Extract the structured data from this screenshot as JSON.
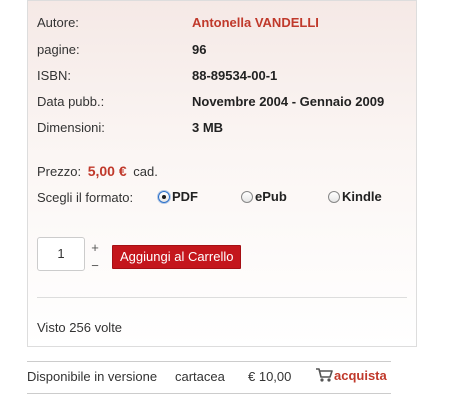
{
  "details": [
    {
      "label": "Autore:",
      "value": "Antonella VANDELLI"
    },
    {
      "label": "pagine:",
      "value": "96"
    },
    {
      "label": "ISBN:",
      "value": "88-89534-00-1"
    },
    {
      "label": "Data pubb.:",
      "value": "Novembre 2004 - Gennaio 2009"
    },
    {
      "label": "Dimensioni:",
      "value": "3 MB"
    }
  ],
  "price": {
    "label": "Prezzo:",
    "value": "5,00 €",
    "unit": "cad."
  },
  "format": {
    "label": "Scegli il formato:",
    "options": [
      "PDF",
      "ePub",
      "Kindle"
    ],
    "selected": "PDF"
  },
  "cart": {
    "quantity": "1",
    "plus": "+",
    "minus": "−",
    "add_label": "Aggiungi al Carrello"
  },
  "views": "Visto 256 volte",
  "availability": {
    "text": "Disponibile in versione",
    "type": "cartacea",
    "price": "€ 10,00",
    "buy_label": "acquista"
  },
  "colors": {
    "accent": "#c4161c",
    "author": "#c0392b"
  }
}
